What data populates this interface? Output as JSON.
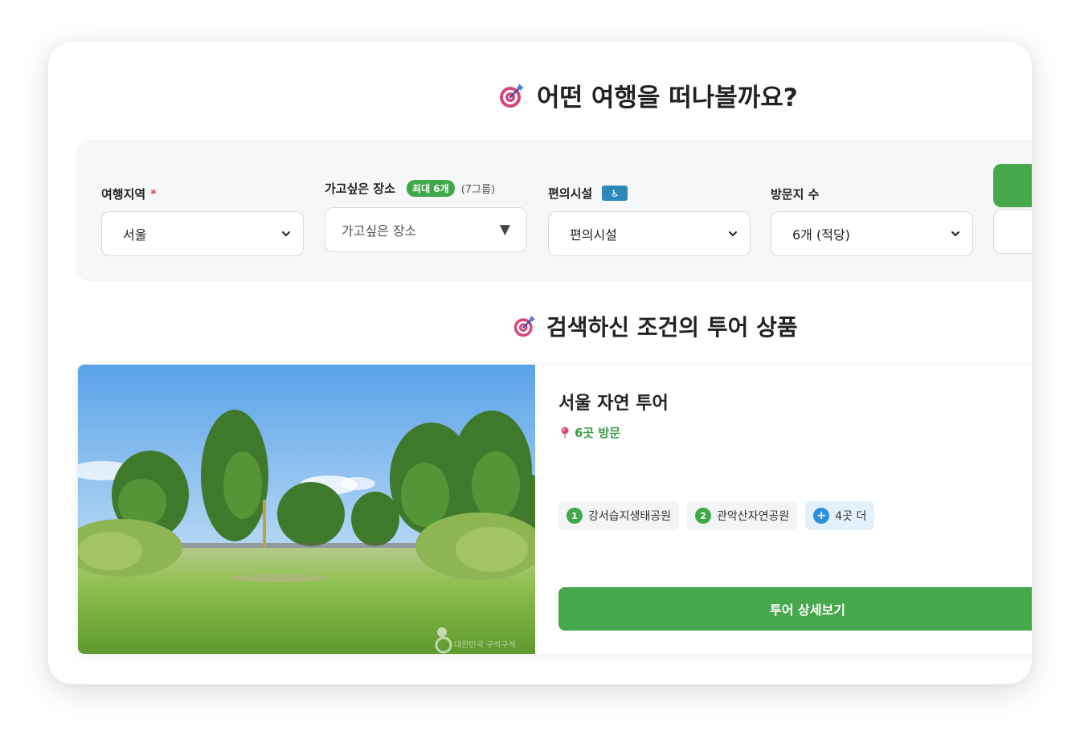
{
  "header": {
    "title": "어떤 여행을 떠나볼까요?",
    "icon": "target-arrow-icon"
  },
  "filters": {
    "region": {
      "label": "여행지역",
      "required_mark": "*",
      "value": "서울"
    },
    "places": {
      "label": "가고싶은 장소",
      "badge": "최대 6개",
      "hint": "(7그룹)",
      "placeholder": "가고싶은 장소"
    },
    "facilities": {
      "label": "편의시설",
      "badge_icon": "wheelchair-accessibility-icon",
      "badge_text": "♿",
      "value": "편의시설"
    },
    "visit_count": {
      "label": "방문지 수",
      "value": "6개 (적당)"
    }
  },
  "results": {
    "title": "검색하신 조건의 투어 상품",
    "icon": "target-arrow-icon",
    "tour": {
      "title": "서울 자연 투어",
      "visits": "6곳 방문",
      "places": [
        {
          "num": "1",
          "name": "강서습지생태공원"
        },
        {
          "num": "2",
          "name": "관악산자연공원"
        }
      ],
      "more": {
        "symbol": "+",
        "label": "4곳 더"
      },
      "detail_button": "투어 상세보기",
      "photo_watermark": "대한민국 구석구석"
    }
  },
  "colors": {
    "accent_green": "#46a84c",
    "required_red": "#e53935",
    "badge_blue": "#2f88ba",
    "more_blue": "#2b8fe0",
    "panel_bg": "#f5f7f8"
  }
}
